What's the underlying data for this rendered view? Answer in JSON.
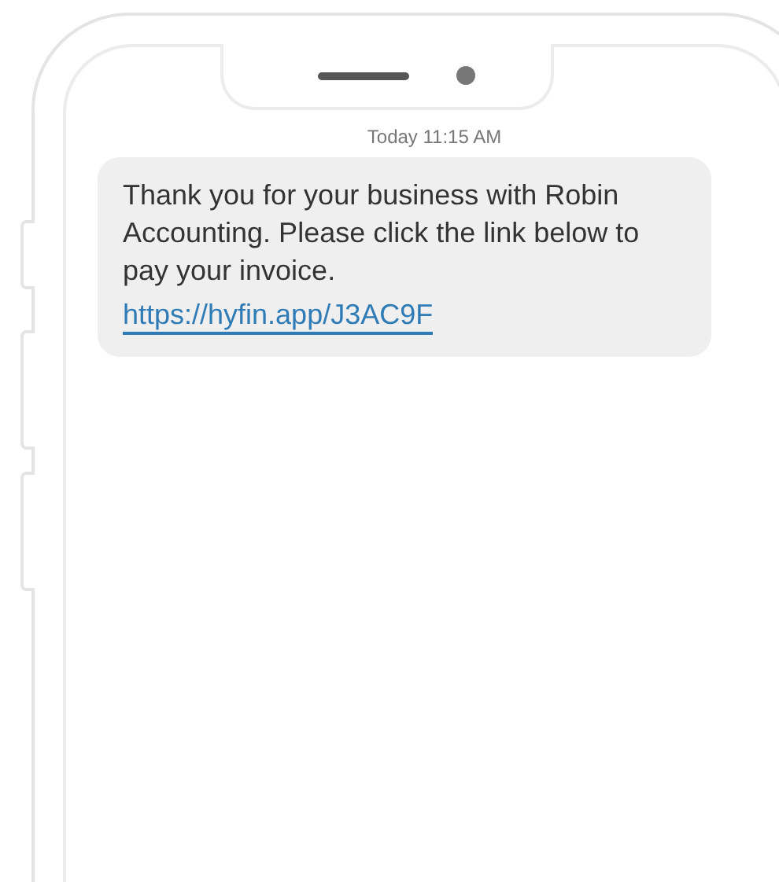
{
  "message_thread": {
    "timestamp": "Today 11:15 AM",
    "messages": [
      {
        "text": "Thank you for your business with Robin Accounting. Please click the link below to pay your invoice.",
        "link": "https://hyfin.app/J3AC9F"
      }
    ]
  }
}
